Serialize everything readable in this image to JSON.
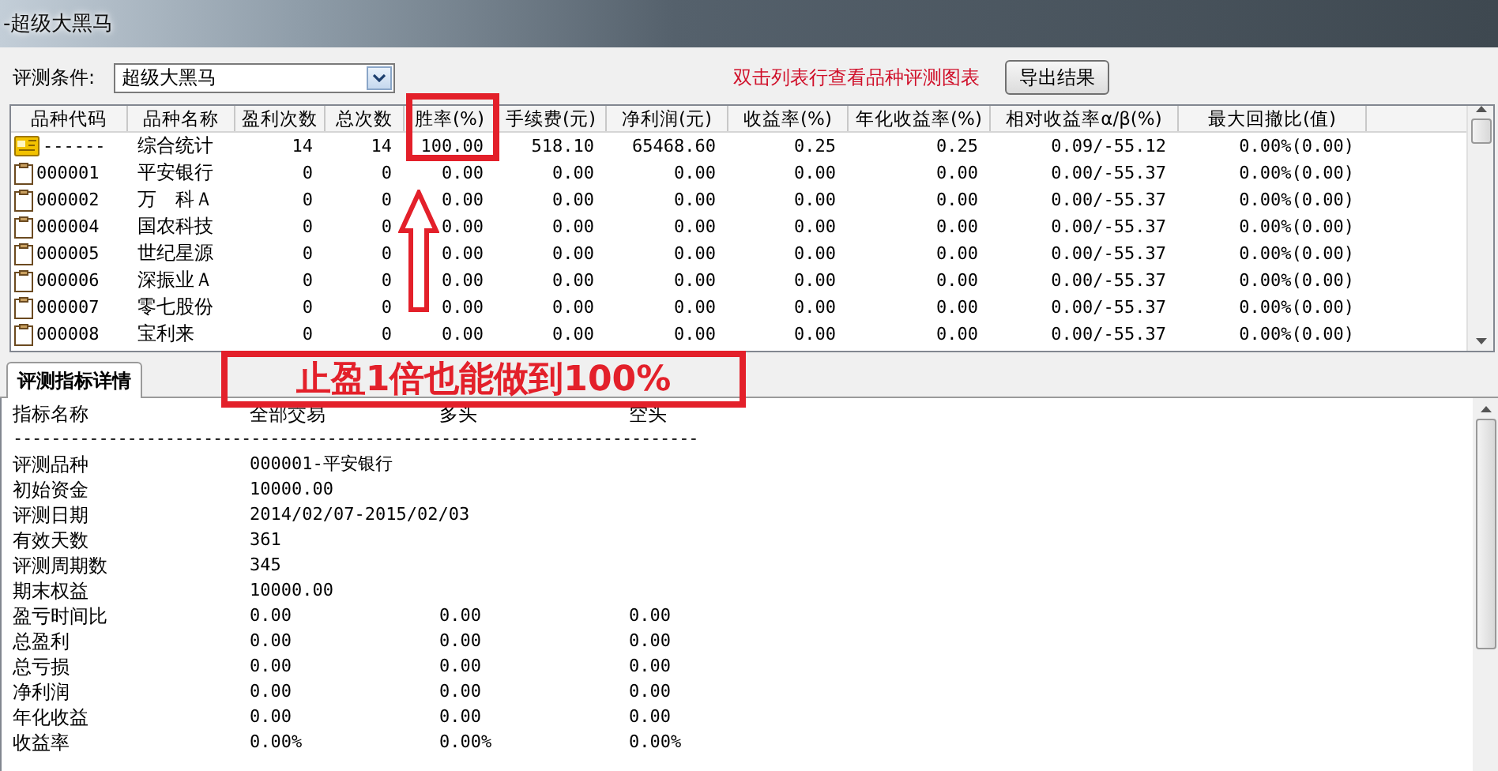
{
  "window": {
    "title": "-超级大黑马"
  },
  "toolbar": {
    "condition_label": "评测条件:",
    "condition_value": "超级大黑马",
    "hint": "双击列表行查看品种评测图表",
    "export_button": "导出结果"
  },
  "table": {
    "columns": [
      "品种代码",
      "品种名称",
      "盈利次数",
      "总次数",
      "胜率(%)",
      "手续费(元)",
      "净利润(元)",
      "收益率(%)",
      "年化收益率(%)",
      "相对收益率α/β(%)",
      "最大回撤比(值)"
    ],
    "rows": [
      {
        "kind": "summary",
        "cells": [
          "------",
          "综合统计",
          "14",
          "14",
          "100.00",
          "518.10",
          "65468.60",
          "0.25",
          "0.25",
          "0.09/-55.12",
          "0.00%(0.00)"
        ]
      },
      {
        "kind": "stock",
        "cells": [
          "000001",
          "平安银行",
          "0",
          "0",
          "0.00",
          "0.00",
          "0.00",
          "0.00",
          "0.00",
          "0.00/-55.37",
          "0.00%(0.00)"
        ]
      },
      {
        "kind": "stock",
        "cells": [
          "000002",
          "万　科Ａ",
          "0",
          "0",
          "0.00",
          "0.00",
          "0.00",
          "0.00",
          "0.00",
          "0.00/-55.37",
          "0.00%(0.00)"
        ]
      },
      {
        "kind": "stock",
        "cells": [
          "000004",
          "国农科技",
          "0",
          "0",
          "0.00",
          "0.00",
          "0.00",
          "0.00",
          "0.00",
          "0.00/-55.37",
          "0.00%(0.00)"
        ]
      },
      {
        "kind": "stock",
        "cells": [
          "000005",
          "世纪星源",
          "0",
          "0",
          "0.00",
          "0.00",
          "0.00",
          "0.00",
          "0.00",
          "0.00/-55.37",
          "0.00%(0.00)"
        ]
      },
      {
        "kind": "stock",
        "cells": [
          "000006",
          "深振业Ａ",
          "0",
          "0",
          "0.00",
          "0.00",
          "0.00",
          "0.00",
          "0.00",
          "0.00/-55.37",
          "0.00%(0.00)"
        ]
      },
      {
        "kind": "stock",
        "cells": [
          "000007",
          "零七股份",
          "0",
          "0",
          "0.00",
          "0.00",
          "0.00",
          "0.00",
          "0.00",
          "0.00/-55.37",
          "0.00%(0.00)"
        ]
      },
      {
        "kind": "stock",
        "cells": [
          "000008",
          "宝利来",
          "0",
          "0",
          "0.00",
          "0.00",
          "0.00",
          "0.00",
          "0.00",
          "0.00/-55.37",
          "0.00%(0.00)"
        ]
      }
    ]
  },
  "detail": {
    "tabs": [
      {
        "label": "评测指标详情",
        "selected": true
      }
    ],
    "columns": [
      "指标名称",
      "全部交易",
      "多头",
      "空头"
    ],
    "separator": "------------------------------------------------------------------------",
    "rows": [
      {
        "cells": [
          "评测品种",
          "000001-平安银行"
        ]
      },
      {
        "cells": [
          "初始资金",
          "10000.00"
        ]
      },
      {
        "cells": [
          "评测日期",
          "2014/02/07-2015/02/03"
        ]
      },
      {
        "cells": [
          "有效天数",
          "361"
        ]
      },
      {
        "cells": [
          "评测周期数",
          "345"
        ]
      },
      {
        "cells": [
          "期末权益",
          "10000.00"
        ]
      },
      {
        "cells": [
          "盈亏时间比",
          "0.00",
          "0.00",
          "0.00"
        ]
      },
      {
        "cells": [
          "总盈利",
          "0.00",
          "0.00",
          "0.00"
        ]
      },
      {
        "cells": [
          "总亏损",
          "0.00",
          "0.00",
          "0.00"
        ]
      },
      {
        "cells": [
          "净利润",
          "0.00",
          "0.00",
          "0.00"
        ]
      },
      {
        "cells": [
          "年化收益",
          "0.00",
          "0.00",
          "0.00"
        ]
      },
      {
        "cells": [
          "收益率",
          "0.00%",
          "0.00%",
          "0.00%"
        ]
      }
    ]
  },
  "annotation": {
    "text": "止盈1倍也能做到100%"
  }
}
